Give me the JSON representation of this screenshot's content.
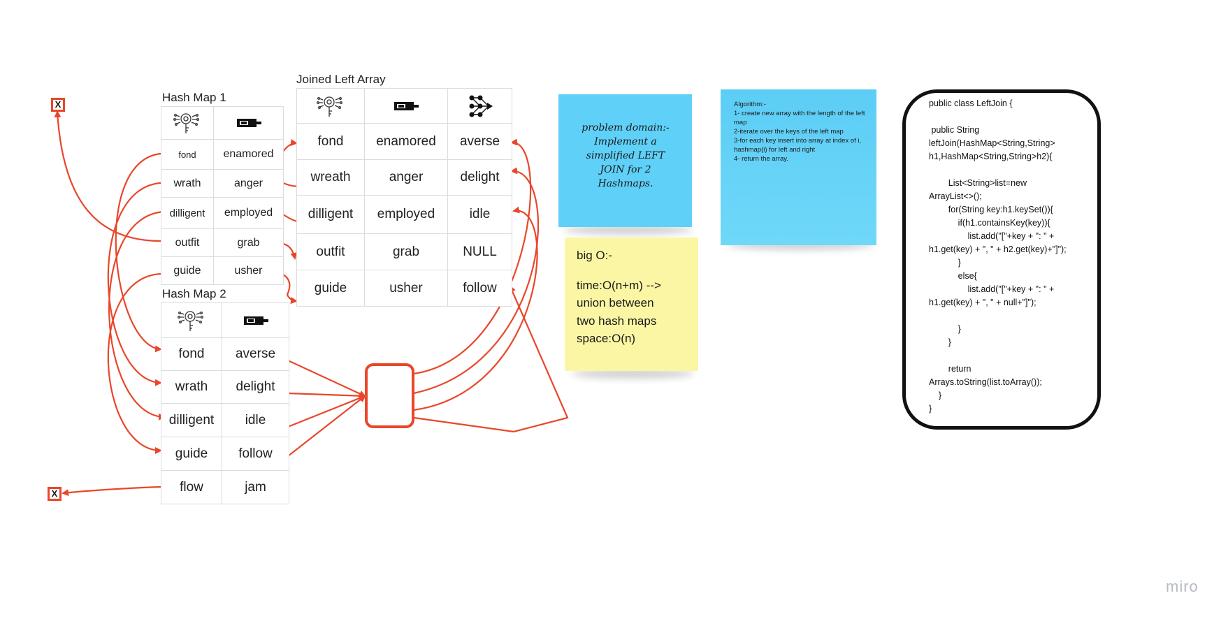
{
  "board_brand": "miro",
  "colors": {
    "arrow": "#e8472b",
    "blue_note": "#5fd0f7",
    "yellow_note": "#fbf6a4",
    "code_border": "#111111"
  },
  "icons": {
    "key_column": "key-icon",
    "value_column": "value-icon",
    "join_column": "network-join-icon"
  },
  "hash_map_1": {
    "title": "Hash Map 1",
    "rows": [
      [
        "fond",
        "enamored"
      ],
      [
        "wrath",
        "anger"
      ],
      [
        "dilligent",
        "employed"
      ],
      [
        "outfit",
        "grab"
      ],
      [
        "guide",
        "usher"
      ]
    ]
  },
  "hash_map_2": {
    "title": "Hash Map 2",
    "rows": [
      [
        "fond",
        "averse"
      ],
      [
        "wrath",
        "delight"
      ],
      [
        "dilligent",
        "idle"
      ],
      [
        "guide",
        "follow"
      ],
      [
        "flow",
        "jam"
      ]
    ]
  },
  "joined": {
    "title": "Joined Left Array",
    "rows": [
      [
        "fond",
        "enamored",
        "averse"
      ],
      [
        "wreath",
        "anger",
        "delight"
      ],
      [
        "dilligent",
        "employed",
        "idle"
      ],
      [
        "outfit",
        "grab",
        "NULL"
      ],
      [
        "guide",
        "usher",
        "follow"
      ]
    ]
  },
  "x_marks": {
    "top": "X",
    "bottom": "X"
  },
  "notes": {
    "problem": "problem domain:- Implement a simplified LEFT JOIN for 2 Hashmaps.",
    "algorithm": [
      "Algorithm:-",
      "1- create new array with the length of the left map",
      "2-iterate over the keys of the left map",
      "3-for each key insert into array at index of i, hashmap(i) for left and right",
      "4- return the array."
    ],
    "big_o": [
      "big O:-",
      "",
      "time:O(n+m) -->",
      "union between",
      "two hash maps",
      "space:O(n)"
    ]
  },
  "code": "public class LeftJoin {\n\n public String\nleftJoin(HashMap<String,String>\nh1,HashMap<String,String>h2){\n\n        List<String>list=new\nArrayList<>();\n        for(String key:h1.keySet()){\n            if(h1.containsKey(key)){\n                list.add(\"[\"+key + \": \" +\nh1.get(key) + \", \" + h2.get(key)+\"]\");\n            }\n            else{\n                list.add(\"[\"+key + \": \" +\nh1.get(key) + \", \" + null+\"]\");\n\n            }\n        }\n\n        return\nArrays.toString(list.toArray());\n    }\n}"
}
